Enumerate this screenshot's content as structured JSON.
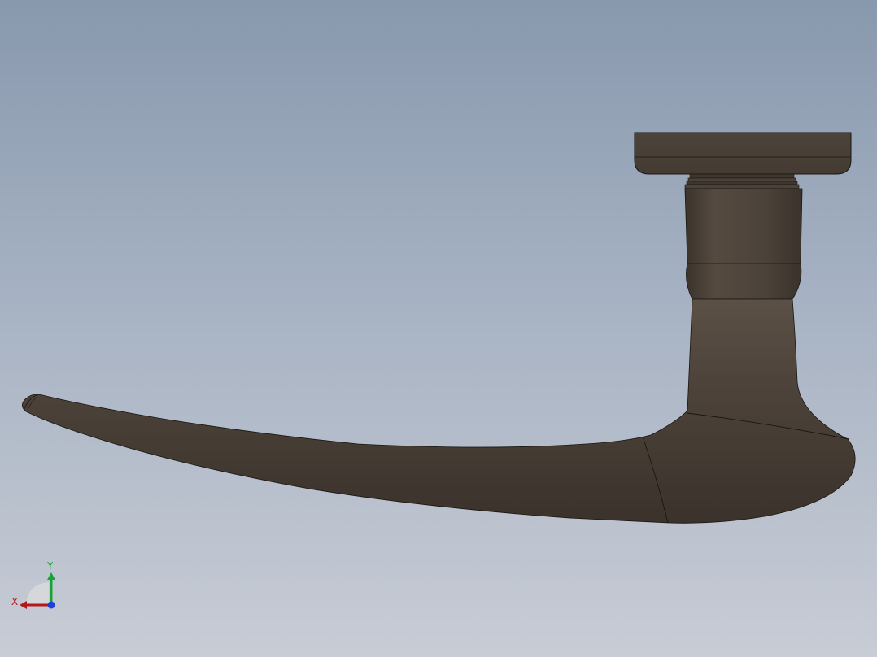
{
  "triad": {
    "x_label": "X",
    "y_label": "Y",
    "x_color": "#b3191c",
    "y_color": "#16a33a",
    "z_color": "#1f3fd8"
  },
  "model": {
    "body_color": "#4a4038",
    "edge_color": "#1a1612"
  },
  "viewport": {
    "background_top": "#8898ad",
    "background_bottom": "#c8ccd5"
  }
}
